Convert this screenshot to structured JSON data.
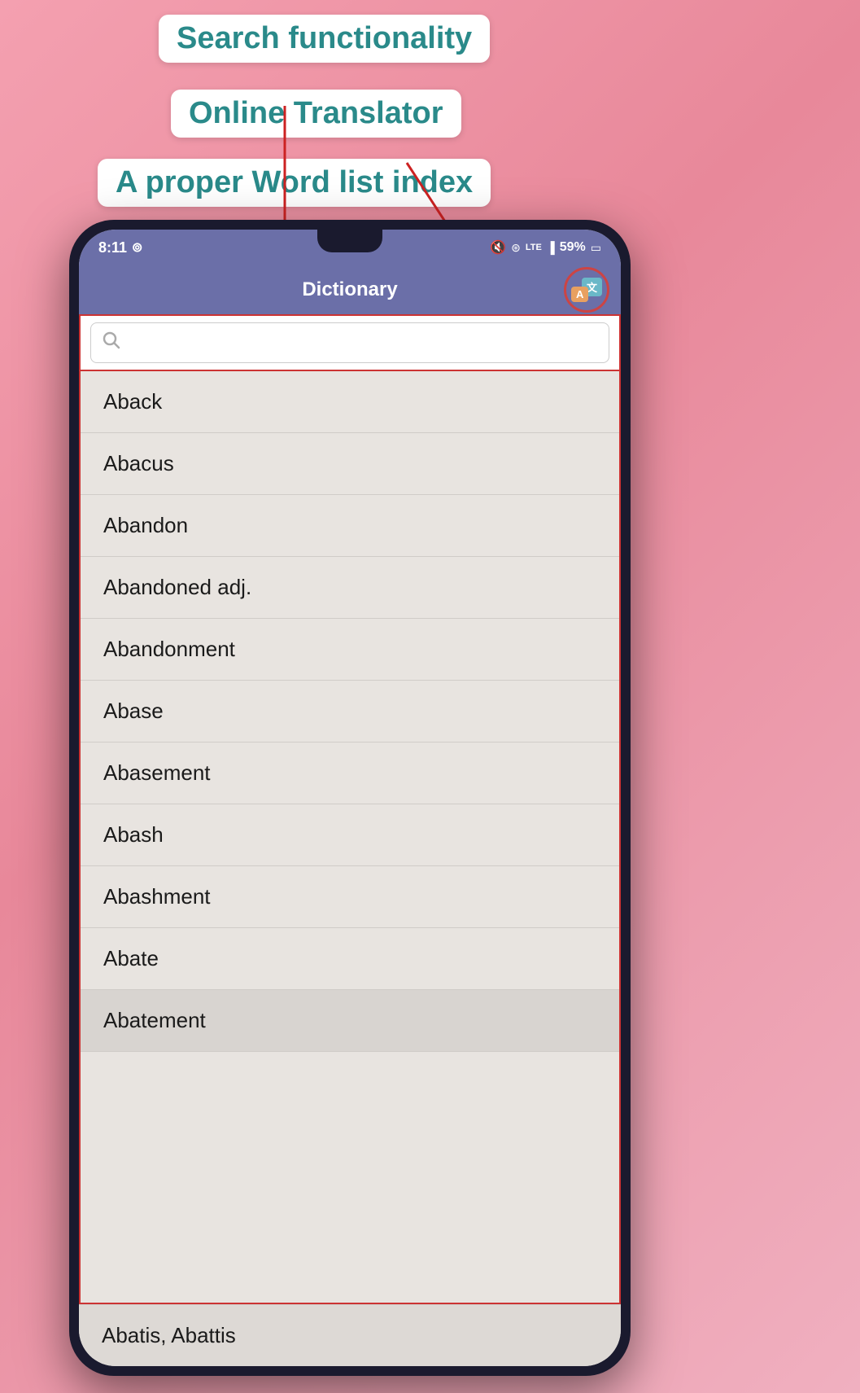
{
  "annotations": {
    "search_label": "Search functionality",
    "translator_label": "Online Translator",
    "wordlist_label": "A proper Word list index"
  },
  "status_bar": {
    "time": "8:11",
    "whatsapp_icon": "⊙",
    "battery": "59%",
    "signal": "|||"
  },
  "app": {
    "title": "Dictionary",
    "translate_zh": "文",
    "translate_en": "A"
  },
  "search": {
    "placeholder": ""
  },
  "words": [
    "Aback",
    "Abacus",
    "Abandon",
    "Abandoned adj.",
    "Abandonment",
    "Abase",
    "Abasement",
    "Abash",
    "Abashment",
    "Abate",
    "Abatement"
  ],
  "partial_word": "Abatis, Abattis",
  "colors": {
    "header_bg": "#6b6fa8",
    "annotation_text": "#2a8a8a",
    "border_red": "#cc3333",
    "arrow_red": "#cc2222"
  }
}
